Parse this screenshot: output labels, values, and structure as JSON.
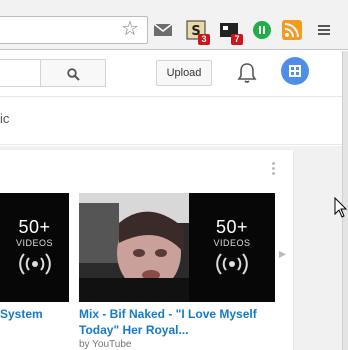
{
  "browser": {
    "extensions": [
      {
        "icon": "gmail-icon",
        "badge": ""
      },
      {
        "icon": "s-extension-icon",
        "badge": "3"
      },
      {
        "icon": "notes-extension-icon",
        "badge": "7"
      },
      {
        "icon": "green-pause-extension-icon",
        "badge": ""
      },
      {
        "icon": "rss-feed-icon",
        "badge": ""
      },
      {
        "icon": "chrome-menu-icon",
        "badge": ""
      }
    ]
  },
  "header": {
    "upload_label": "Upload"
  },
  "subbar": {
    "text": "ic"
  },
  "playlists": [
    {
      "count": "50+",
      "count_label": "VIDEOS",
      "title": "System",
      "byline": ""
    },
    {
      "count": "50+",
      "count_label": "VIDEOS",
      "title": "Mix - Bif Naked - \"I Love Myself Today\" Her Royal...",
      "byline": "by YouTube"
    }
  ],
  "colors": {
    "link": "#167ac6",
    "avatar": "#4f8ee8",
    "badge": "#d0131c"
  }
}
